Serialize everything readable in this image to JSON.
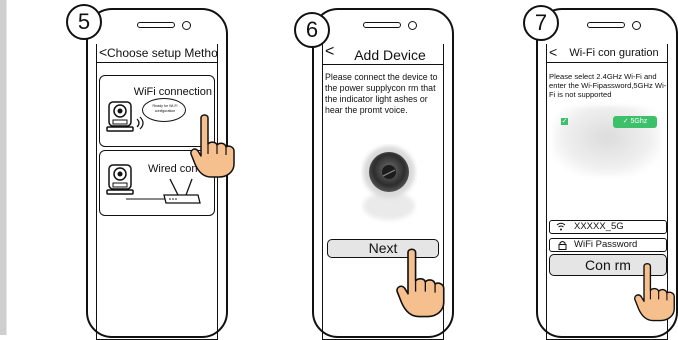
{
  "steps": [
    {
      "number": "5",
      "title": "Choose setup Method",
      "option_wifi": "WiFi connection",
      "bubble_text": "Ready for Wi-Fi configuration",
      "option_wired": "Wired con     n"
    },
    {
      "number": "6",
      "title": "Add Device",
      "instructions": "Please connect the device to the power supplycon  rm that the indicator light   ashes or hear the promt voice.",
      "button": "Next"
    },
    {
      "number": "7",
      "title": "Wi-Fi con  guration",
      "instructions": "Please select 2.4GHz Wi-Fi and enter the Wi-Fipassword,5GHz Wi-Fi is not supported",
      "tag_5ghz": "✓ 5Ghz",
      "ssid": "XXXXX_5G",
      "password_placeholder": "WiFi Password",
      "button": "Con  rm"
    }
  ],
  "colors": {
    "outline": "#111111",
    "hand": "#f5bf8e",
    "green": "#3cc06a",
    "left_bar": "#cfcfcf"
  },
  "icons": [
    "back-chevron-icon",
    "camera-device-icon",
    "wifi-signal-icon",
    "router-icon",
    "pointing-hand-icon",
    "wifi-icon",
    "lock-icon"
  ]
}
